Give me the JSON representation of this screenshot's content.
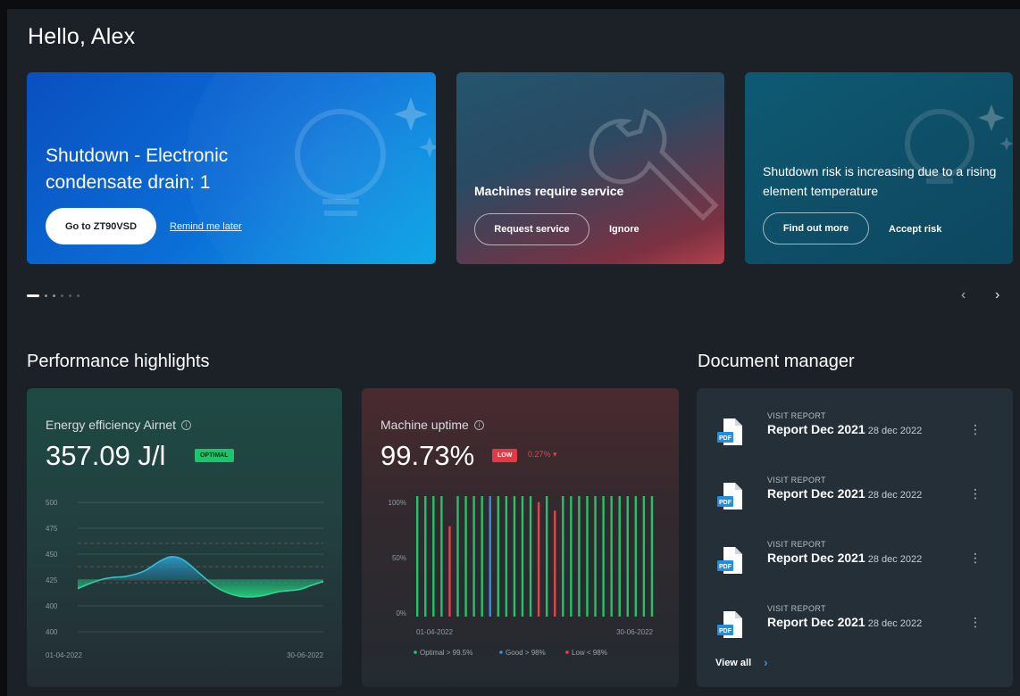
{
  "greeting": "Hello, Alex",
  "banners": [
    {
      "title": "Shutdown - Electronic condensate drain: 1",
      "primary": "Go to  ZT90VSD",
      "secondary": "Remind me later"
    },
    {
      "title": "Machines require service",
      "primary": "Request service",
      "secondary": "Ignore"
    },
    {
      "title": "Shutdown risk is increasing due to a rising element temperature",
      "primary": "Find out more",
      "secondary": "Accept risk"
    }
  ],
  "carousel": {
    "prev": "‹",
    "next": "›"
  },
  "performance": {
    "title": "Performance highlights",
    "energy": {
      "label": "Energy efficiency Airnet",
      "value": "357.09  J/l",
      "badge": "OPTIMAL",
      "info_icon": "info-icon",
      "chart_data": {
        "type": "area",
        "y_ticks": [
          "500",
          "475",
          "450",
          "425",
          "400",
          "400"
        ],
        "x_labels": [
          "01-04-2022",
          "30-06-2022"
        ],
        "series_line": [
          [
            0.0,
            416
          ],
          [
            0.05,
            421
          ],
          [
            0.1,
            425
          ],
          [
            0.15,
            427
          ],
          [
            0.2,
            428
          ],
          [
            0.27,
            433
          ],
          [
            0.33,
            442
          ],
          [
            0.38,
            447
          ],
          [
            0.43,
            444
          ],
          [
            0.5,
            430
          ],
          [
            0.56,
            418
          ],
          [
            0.62,
            411
          ],
          [
            0.68,
            408
          ],
          [
            0.75,
            409
          ],
          [
            0.82,
            413
          ],
          [
            0.9,
            415
          ],
          [
            0.95,
            419
          ],
          [
            1.0,
            423
          ]
        ]
      }
    },
    "uptime": {
      "label": "Machine uptime",
      "value": "99.73%",
      "badge": "LOW",
      "delta": "0.27% ▾",
      "info_icon": "info-icon",
      "chart_data": {
        "type": "bar",
        "y_ticks": [
          "100%",
          "50%",
          "0%"
        ],
        "x_labels": [
          "01-04-2022",
          "30-06-2022"
        ],
        "legend": [
          "Optimal > 99.5%",
          "Good > 98%",
          "Low < 98%"
        ],
        "colors": {
          "optimal": "#21c46a",
          "good": "#2f8fe8",
          "low": "#e0454d"
        },
        "bars": [
          {
            "v": 1.0,
            "s": "optimal"
          },
          {
            "v": 1.0,
            "s": "optimal"
          },
          {
            "v": 1.0,
            "s": "optimal"
          },
          {
            "v": 1.0,
            "s": "optimal"
          },
          {
            "v": 0.75,
            "s": "low"
          },
          {
            "v": 1.0,
            "s": "optimal"
          },
          {
            "v": 1.0,
            "s": "optimal"
          },
          {
            "v": 1.0,
            "s": "optimal"
          },
          {
            "v": 1.0,
            "s": "optimal"
          },
          {
            "v": 1.0,
            "s": "good"
          },
          {
            "v": 1.0,
            "s": "optimal"
          },
          {
            "v": 1.0,
            "s": "optimal"
          },
          {
            "v": 1.0,
            "s": "optimal"
          },
          {
            "v": 1.0,
            "s": "optimal"
          },
          {
            "v": 1.0,
            "s": "optimal"
          },
          {
            "v": 0.95,
            "s": "low"
          },
          {
            "v": 1.0,
            "s": "optimal"
          },
          {
            "v": 0.88,
            "s": "low"
          },
          {
            "v": 1.0,
            "s": "optimal"
          },
          {
            "v": 1.0,
            "s": "optimal"
          },
          {
            "v": 1.0,
            "s": "optimal"
          },
          {
            "v": 1.0,
            "s": "optimal"
          },
          {
            "v": 1.0,
            "s": "optimal"
          },
          {
            "v": 1.0,
            "s": "optimal"
          },
          {
            "v": 1.0,
            "s": "optimal"
          },
          {
            "v": 1.0,
            "s": "optimal"
          },
          {
            "v": 1.0,
            "s": "optimal"
          },
          {
            "v": 1.0,
            "s": "optimal"
          },
          {
            "v": 1.0,
            "s": "optimal"
          },
          {
            "v": 1.0,
            "s": "optimal"
          }
        ]
      }
    }
  },
  "documents": {
    "title": "Document manager",
    "items": [
      {
        "type": "VISIT REPORT",
        "name": "Report Dec 2021",
        "date": "28 dec 2022"
      },
      {
        "type": "VISIT REPORT",
        "name": "Report Dec 2021",
        "date": "28 dec 2022"
      },
      {
        "type": "VISIT REPORT",
        "name": "Report Dec 2021",
        "date": "28 dec 2022"
      },
      {
        "type": "VISIT REPORT",
        "name": "Report Dec 2021",
        "date": "28 dec 2022"
      }
    ],
    "file_badge": "PDF",
    "kebab": "⋮",
    "view_all": "View all",
    "view_all_icon": "›"
  }
}
